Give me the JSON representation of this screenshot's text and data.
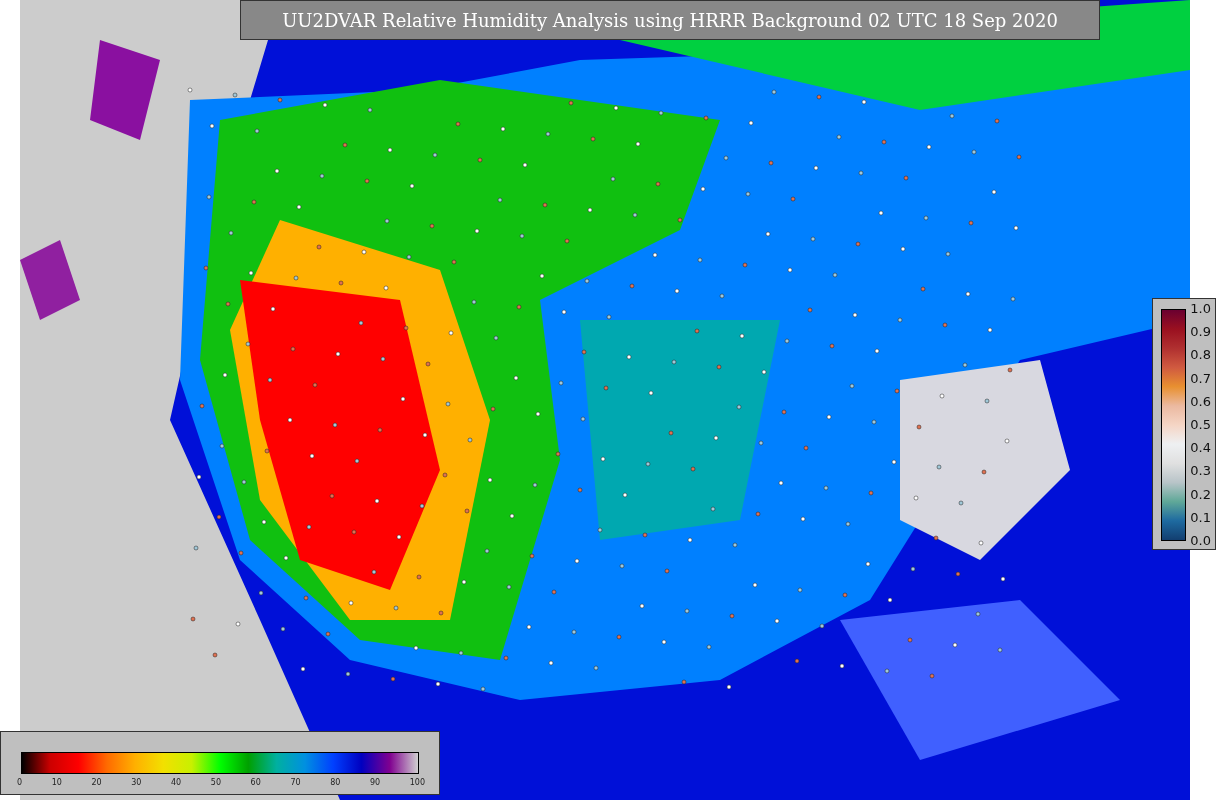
{
  "title": "UU2DVAR Relative Humidity Analysis using HRRR Background 02 UTC 18 Sep 2020",
  "humidity_colorbar": {
    "ticks": [
      "0",
      "10",
      "20",
      "30",
      "40",
      "50",
      "60",
      "70",
      "80",
      "90",
      "100"
    ]
  },
  "station_colorbar": {
    "ticks": [
      "1.0",
      "0.9",
      "0.8",
      "0.7",
      "0.6",
      "0.5",
      "0.4",
      "0.3",
      "0.2",
      "0.1",
      "0.0"
    ]
  }
}
